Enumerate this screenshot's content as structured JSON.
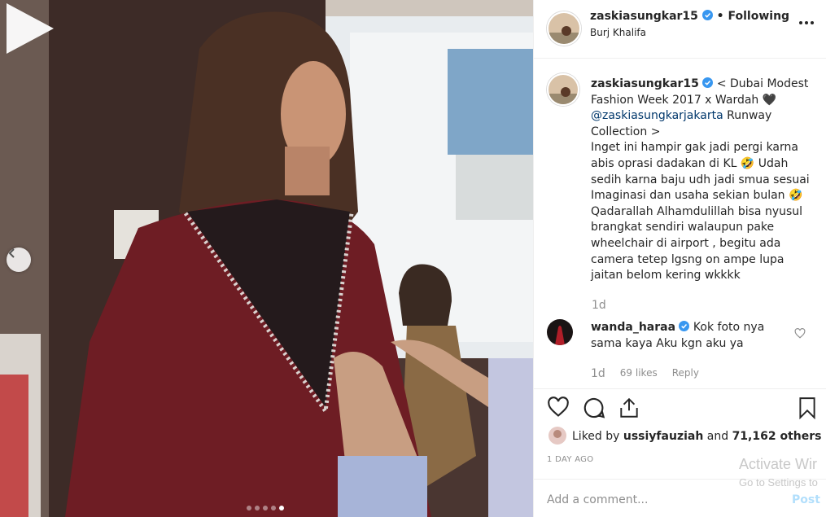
{
  "media": {
    "carousel_dots": 5,
    "active_dot_index": 4
  },
  "header": {
    "username": "zaskiasungkar15",
    "separator": "•",
    "follow_status": "Following",
    "location": "Burj Khalifa",
    "more_icon": "more-horizontal-icon"
  },
  "caption": {
    "username": "zaskiasungkar15",
    "text_before_mention": " < Dubai Modest Fashion Week 2017 x Wardah 🖤 ",
    "mention": "@zaskiasungkarjakarta",
    "text_after_mention": " Runway Collection >",
    "body": "Inget ini hampir gak jadi pergi karna abis oprasi dadakan di KL 🤣 Udah sedih karna baju udh jadi smua sesuai Imaginasi dan usaha sekian bulan 🤣 Qadarallah Alhamdulillah bisa nyusul brangkat sendiri walaupun pake wheelchair di airport , begitu ada camera tetep lgsng on ampe lupa jaitan belom kering wkkkk",
    "time": "1d"
  },
  "comment": {
    "username": "wanda_haraa",
    "text": " Kok foto nya sama kaya Aku kgn aku ya",
    "time": "1d",
    "likes": "69 likes",
    "reply": "Reply"
  },
  "likes": {
    "prefix": "Liked by ",
    "user": "ussiyfauziah",
    "middle": " and ",
    "others": "71,162 others"
  },
  "posted_ago": "1 DAY AGO",
  "add_comment": {
    "placeholder": "Add a comment...",
    "post_label": "Post"
  },
  "watermark": {
    "line1": "Activate Wir",
    "line2": "Go to Settings to"
  },
  "colors": {
    "verified": "#3897f0",
    "link": "#00376b",
    "muted": "#8e8e8e",
    "post_disabled": "#b2dffc"
  }
}
